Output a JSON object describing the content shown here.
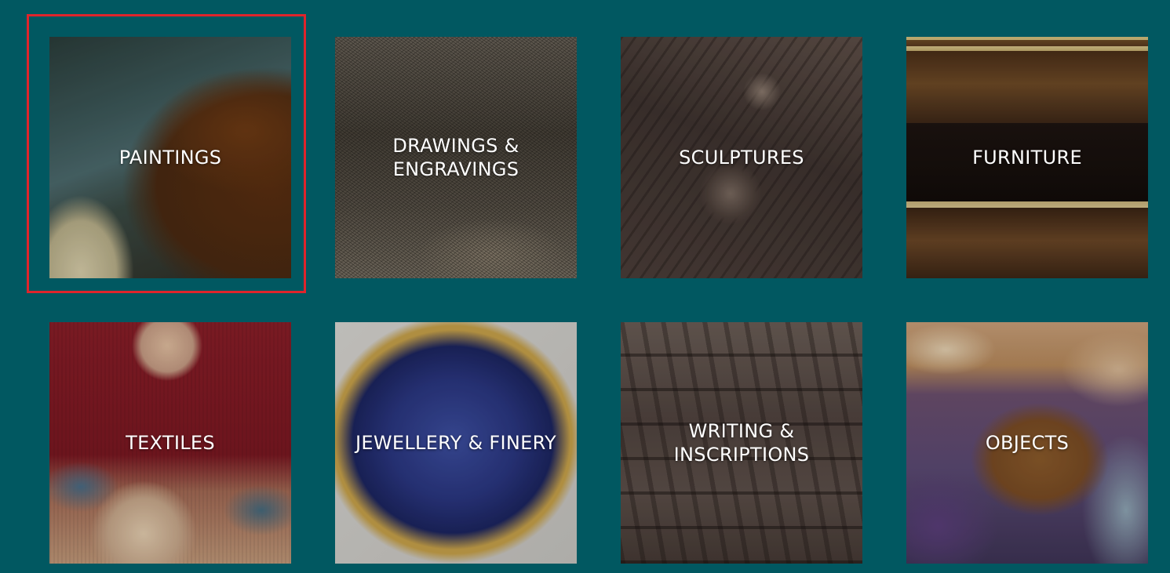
{
  "colors": {
    "background": "#015861",
    "focus_ring": "#e0242b",
    "label_text": "#ffffff"
  },
  "categories": [
    {
      "id": "paintings",
      "line1": "PAINTINGS",
      "line2": ""
    },
    {
      "id": "drawings",
      "line1": "DRAWINGS &",
      "line2": "ENGRAVINGS"
    },
    {
      "id": "sculptures",
      "line1": "SCULPTURES",
      "line2": ""
    },
    {
      "id": "furniture",
      "line1": "FURNITURE",
      "line2": ""
    },
    {
      "id": "textiles",
      "line1": "TEXTILES",
      "line2": ""
    },
    {
      "id": "jewellery",
      "line1": "JEWELLERY & FINERY",
      "line2": ""
    },
    {
      "id": "writing",
      "line1": "WRITING &",
      "line2": "INSCRIPTIONS"
    },
    {
      "id": "objects",
      "line1": "OBJECTS",
      "line2": ""
    }
  ],
  "focused_category": "paintings"
}
